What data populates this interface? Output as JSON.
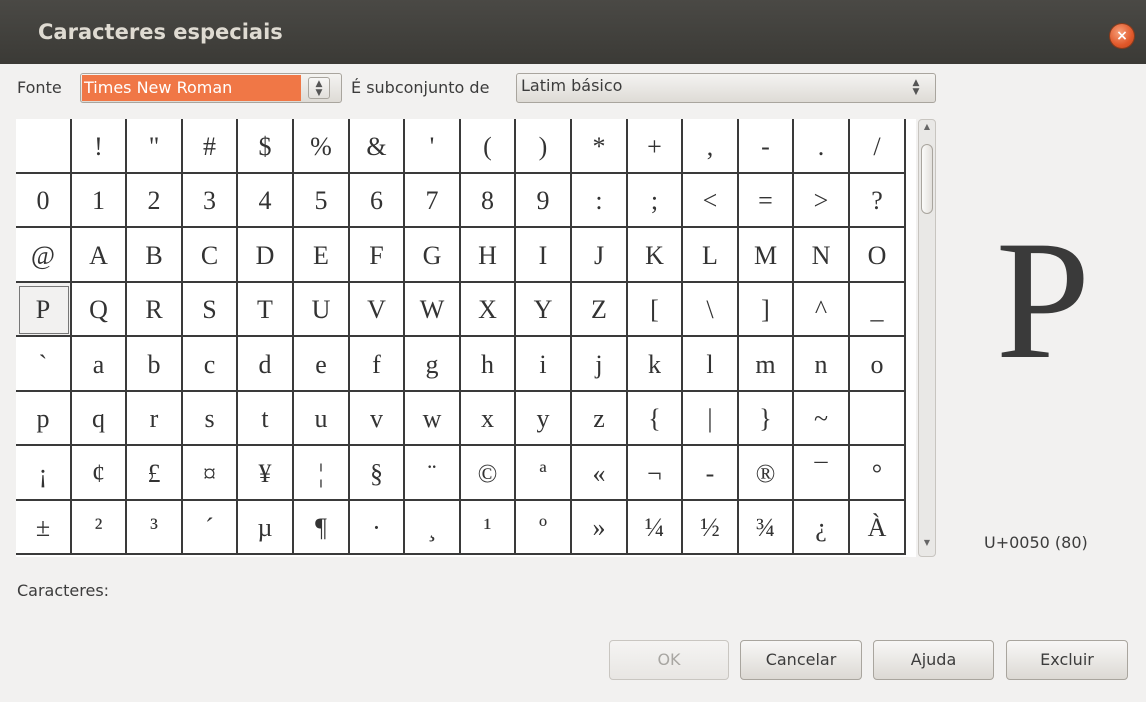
{
  "window": {
    "title": "Caracteres especiais",
    "close_glyph": "×"
  },
  "toolbar": {
    "font_label": "Fonte",
    "font_value": "Times New Roman",
    "subset_label": "É subconjunto de",
    "subset_value": "Latim básico",
    "spin_up": "▲",
    "spin_down": "▼"
  },
  "grid": {
    "rows": [
      [
        " ",
        "!",
        "\"",
        "#",
        "$",
        "%",
        "&",
        "'",
        "(",
        ")",
        "*",
        "+",
        ",",
        "-",
        ".",
        "/"
      ],
      [
        "0",
        "1",
        "2",
        "3",
        "4",
        "5",
        "6",
        "7",
        "8",
        "9",
        ":",
        ";",
        "<",
        "=",
        ">",
        "?"
      ],
      [
        "@",
        "A",
        "B",
        "C",
        "D",
        "E",
        "F",
        "G",
        "H",
        "I",
        "J",
        "K",
        "L",
        "M",
        "N",
        "O"
      ],
      [
        "P",
        "Q",
        "R",
        "S",
        "T",
        "U",
        "V",
        "W",
        "X",
        "Y",
        "Z",
        "[",
        "\\",
        "]",
        "^",
        "_"
      ],
      [
        "`",
        "a",
        "b",
        "c",
        "d",
        "e",
        "f",
        "g",
        "h",
        "i",
        "j",
        "k",
        "l",
        "m",
        "n",
        "o"
      ],
      [
        "p",
        "q",
        "r",
        "s",
        "t",
        "u",
        "v",
        "w",
        "x",
        "y",
        "z",
        "{",
        "|",
        "}",
        "~",
        " "
      ],
      [
        "¡",
        "¢",
        "£",
        "¤",
        "¥",
        "¦",
        "§",
        "¨",
        "©",
        "ª",
        "«",
        "¬",
        "-",
        "®",
        "¯",
        "°"
      ],
      [
        "±",
        "²",
        "³",
        "´",
        "µ",
        "¶",
        "·",
        "¸",
        "¹",
        "º",
        "»",
        "¼",
        "½",
        "¾",
        "¿",
        "À"
      ]
    ],
    "selected": "P"
  },
  "scrollbar": {
    "up": "▲",
    "down": "▼"
  },
  "preview": {
    "char": "P",
    "code": "U+0050 (80)"
  },
  "characters_label": "Caracteres:",
  "buttons": {
    "ok": "OK",
    "cancel": "Cancelar",
    "help": "Ajuda",
    "delete": "Excluir"
  }
}
